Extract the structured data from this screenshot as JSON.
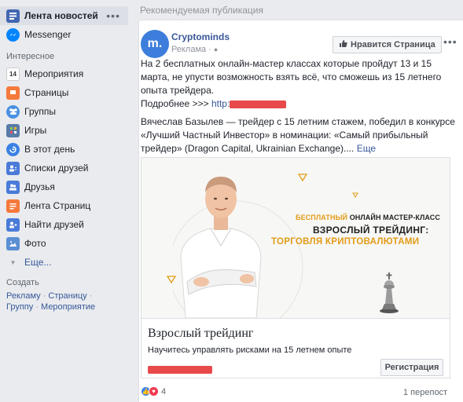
{
  "sidebar": {
    "items": [
      {
        "label": "Лента новостей",
        "icon": "news-feed-icon",
        "color": "#4267b2",
        "active": true
      },
      {
        "label": "Messenger",
        "icon": "messenger-icon",
        "color": "#0084ff"
      }
    ],
    "interesting_title": "Интересное",
    "interesting": [
      {
        "label": "Мероприятия",
        "icon": "calendar-icon",
        "color": "#e9ebee",
        "glyph": "14"
      },
      {
        "label": "Страницы",
        "icon": "flag-icon",
        "color": "#f5793b"
      },
      {
        "label": "Группы",
        "icon": "groups-icon",
        "color": "#4a90e2"
      },
      {
        "label": "Игры",
        "icon": "games-icon",
        "color": "#587ba8"
      },
      {
        "label": "В этот день",
        "icon": "on-this-day-icon",
        "color": "#3a81e4"
      },
      {
        "label": "Списки друзей",
        "icon": "friend-lists-icon",
        "color": "#4a7bd8"
      },
      {
        "label": "Друзья",
        "icon": "friends-icon",
        "color": "#4a7bd8"
      },
      {
        "label": "Лента Страниц",
        "icon": "pages-feed-icon",
        "color": "#f5793b"
      },
      {
        "label": "Найти друзей",
        "icon": "find-friends-icon",
        "color": "#4a7bd8"
      },
      {
        "label": "Фото",
        "icon": "photo-icon",
        "color": "#5b8fd4"
      }
    ],
    "more_label": "Еще...",
    "create_title": "Создать",
    "create_links": [
      "Рекламу",
      "Страницу",
      "Группу",
      "Мероприятие"
    ]
  },
  "feed": {
    "header": "Рекомендуемая публикация",
    "post": {
      "avatar_letter": "m.",
      "page_name": "Cryptominds",
      "sponsored": "Реклама · ",
      "like_page_label": "Нравится Страница",
      "text_line1": "На 2 бесплатных онлайн-мастер классах которые пройдут 13 и 15 марта, не упусти возможность взять всё, что сможешь из 15 летнего опыта трейдера.",
      "more_prefix": "Подробнее >>> ",
      "link_prefix": "http:",
      "text_line2": "Вячеслав Базылев — трейдер с 15 летним стажем, победил в конкурсе «Лучший Частный Инвестор» в номинации: «Самый прибыльный трейдер» (Dragon Capital, Ukrainian Exchange).... ",
      "more_label": "Еще",
      "card": {
        "promo_free_orange": "БЕСПЛАТНЫЙ",
        "promo_free_rest": " ОНЛАЙН МАСТЕР-КЛАСС",
        "promo_title": "ВЗРОСЛЫЙ ТРЕЙДИНГ:",
        "promo_sub": "ТОРГОВЛЯ КРИПТОВАЛЮТАМИ",
        "title": "Взрослый трейдинг",
        "description": "Научитесь управлять рисками на 15 летнем опыте",
        "button": "Регистрация"
      },
      "reaction_count": "4",
      "shares": "1 перепост"
    }
  }
}
